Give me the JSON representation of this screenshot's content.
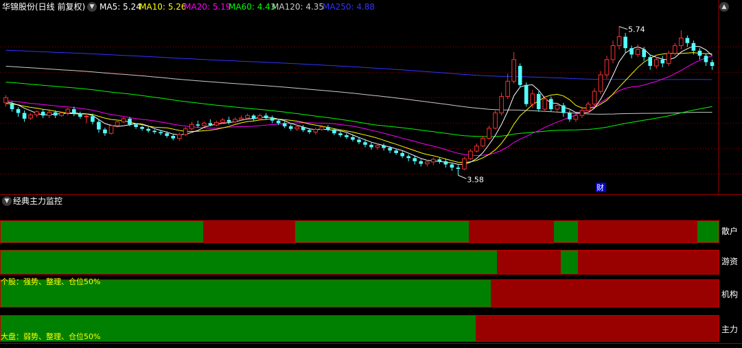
{
  "header": {
    "stock_label": "华锦股份(日线 前复权)",
    "ma_items": [
      {
        "label": "MA5: 5.24",
        "color": "#ffffff"
      },
      {
        "label": "MA10: 5.26",
        "color": "#ffff00"
      },
      {
        "label": "MA20: 5.19",
        "color": "#ff00ff"
      },
      {
        "label": "MA60: 4.43",
        "color": "#00ff00"
      },
      {
        "label": "MA120: 4.35",
        "color": "#cccccc"
      },
      {
        "label": "MA250: 4.88",
        "color": "#3333ff"
      }
    ]
  },
  "colors": {
    "up": "#ff3232",
    "down": "#54ffff",
    "bull": "#008000",
    "bear": "#990000",
    "grid": "#a00000",
    "annotation": "#ffffff",
    "event": "#0000cc"
  },
  "chart_data": {
    "type": "candlestick",
    "ylim": [
      3.4,
      6.1
    ],
    "high_label": "5.74",
    "low_label": "3.58",
    "event_label": "财",
    "candles": [
      [
        4.72,
        4.8,
        4.66,
        4.84
      ],
      [
        4.7,
        4.62,
        4.58,
        4.74
      ],
      [
        4.62,
        4.56,
        4.5,
        4.65
      ],
      [
        4.56,
        4.47,
        4.42,
        4.6
      ],
      [
        4.48,
        4.53,
        4.45,
        4.56
      ],
      [
        4.53,
        4.58,
        4.49,
        4.6
      ],
      [
        4.58,
        4.52,
        4.48,
        4.62
      ],
      [
        4.52,
        4.57,
        4.48,
        4.6
      ],
      [
        4.57,
        4.52,
        4.48,
        4.6
      ],
      [
        4.52,
        4.56,
        4.5,
        4.58
      ],
      [
        4.56,
        4.62,
        4.52,
        4.64
      ],
      [
        4.62,
        4.55,
        4.51,
        4.66
      ],
      [
        4.55,
        4.5,
        4.47,
        4.58
      ],
      [
        4.5,
        4.51,
        4.4,
        4.55
      ],
      [
        4.51,
        4.42,
        4.38,
        4.55
      ],
      [
        4.42,
        4.3,
        4.25,
        4.46
      ],
      [
        4.3,
        4.24,
        4.2,
        4.33
      ],
      [
        4.24,
        4.36,
        4.22,
        4.38
      ],
      [
        4.36,
        4.42,
        4.33,
        4.45
      ],
      [
        4.42,
        4.47,
        4.4,
        4.49
      ],
      [
        4.47,
        4.38,
        4.35,
        4.5
      ],
      [
        4.38,
        4.34,
        4.31,
        4.4
      ],
      [
        4.34,
        4.31,
        4.28,
        4.36
      ],
      [
        4.31,
        4.28,
        4.25,
        4.34
      ],
      [
        4.28,
        4.26,
        4.23,
        4.3
      ],
      [
        4.26,
        4.24,
        4.21,
        4.29
      ],
      [
        4.24,
        4.2,
        4.17,
        4.27
      ],
      [
        4.2,
        4.16,
        4.13,
        4.22
      ],
      [
        4.16,
        4.22,
        4.12,
        4.25
      ],
      [
        4.22,
        4.31,
        4.2,
        4.34
      ],
      [
        4.31,
        4.38,
        4.29,
        4.42
      ],
      [
        4.38,
        4.36,
        4.33,
        4.44
      ],
      [
        4.36,
        4.4,
        4.34,
        4.43
      ],
      [
        4.4,
        4.37,
        4.35,
        4.46
      ],
      [
        4.37,
        4.41,
        4.35,
        4.44
      ],
      [
        4.41,
        4.45,
        4.39,
        4.48
      ],
      [
        4.45,
        4.42,
        4.38,
        4.5
      ],
      [
        4.42,
        4.46,
        4.4,
        4.49
      ],
      [
        4.46,
        4.48,
        4.44,
        4.52
      ],
      [
        4.48,
        4.52,
        4.45,
        4.55
      ],
      [
        4.52,
        4.47,
        4.43,
        4.54
      ],
      [
        4.47,
        4.52,
        4.44,
        4.55
      ],
      [
        4.52,
        4.48,
        4.45,
        4.56
      ],
      [
        4.48,
        4.44,
        4.4,
        4.52
      ],
      [
        4.44,
        4.4,
        4.37,
        4.47
      ],
      [
        4.4,
        4.35,
        4.32,
        4.43
      ],
      [
        4.35,
        4.31,
        4.28,
        4.38
      ],
      [
        4.31,
        4.34,
        4.28,
        4.37
      ],
      [
        4.34,
        4.29,
        4.26,
        4.37
      ],
      [
        4.29,
        4.26,
        4.23,
        4.32
      ],
      [
        4.26,
        4.3,
        4.22,
        4.33
      ],
      [
        4.3,
        4.34,
        4.28,
        4.37
      ],
      [
        4.34,
        4.3,
        4.27,
        4.37
      ],
      [
        4.3,
        4.24,
        4.21,
        4.32
      ],
      [
        4.24,
        4.21,
        4.18,
        4.27
      ],
      [
        4.21,
        4.18,
        4.15,
        4.24
      ],
      [
        4.18,
        4.14,
        4.11,
        4.21
      ],
      [
        4.14,
        4.1,
        4.07,
        4.17
      ],
      [
        4.1,
        4.06,
        4.02,
        4.13
      ],
      [
        4.06,
        4.02,
        3.98,
        4.09
      ],
      [
        4.02,
        4.05,
        3.98,
        4.08
      ],
      [
        4.05,
        4.01,
        3.97,
        4.08
      ],
      [
        4.01,
        3.97,
        3.93,
        4.04
      ],
      [
        3.97,
        3.93,
        3.9,
        4.0
      ],
      [
        3.93,
        3.88,
        3.85,
        3.96
      ],
      [
        3.88,
        3.85,
        3.8,
        3.91
      ],
      [
        3.85,
        3.8,
        3.75,
        3.88
      ],
      [
        3.8,
        3.76,
        3.72,
        3.83
      ],
      [
        3.76,
        3.79,
        3.72,
        3.82
      ],
      [
        3.79,
        3.83,
        3.74,
        3.86
      ],
      [
        3.83,
        3.8,
        3.76,
        3.86
      ],
      [
        3.8,
        3.75,
        3.7,
        3.84
      ],
      [
        3.75,
        3.7,
        3.65,
        3.78
      ],
      [
        3.7,
        3.68,
        3.58,
        3.74
      ],
      [
        3.68,
        3.84,
        3.66,
        3.87
      ],
      [
        3.84,
        3.96,
        3.82,
        3.99
      ],
      [
        3.96,
        4.04,
        3.94,
        4.08
      ],
      [
        4.04,
        4.16,
        4.02,
        4.2
      ],
      [
        4.16,
        4.32,
        4.14,
        4.36
      ],
      [
        4.32,
        4.56,
        4.3,
        4.6
      ],
      [
        4.56,
        4.82,
        4.52,
        4.88
      ],
      [
        4.82,
        5.06,
        4.78,
        5.18
      ],
      [
        5.06,
        5.4,
        5.02,
        5.52
      ],
      [
        5.3,
        5.0,
        4.96,
        5.34
      ],
      [
        5.0,
        4.7,
        4.66,
        5.04
      ],
      [
        4.7,
        4.86,
        4.64,
        4.92
      ],
      [
        4.86,
        4.62,
        4.58,
        4.9
      ],
      [
        4.62,
        4.78,
        4.58,
        4.82
      ],
      [
        4.78,
        4.62,
        4.58,
        4.82
      ],
      [
        4.62,
        4.68,
        4.56,
        4.72
      ],
      [
        4.68,
        4.56,
        4.5,
        4.72
      ],
      [
        4.56,
        4.46,
        4.42,
        4.6
      ],
      [
        4.46,
        4.52,
        4.42,
        4.56
      ],
      [
        4.52,
        4.6,
        4.48,
        4.66
      ],
      [
        4.6,
        4.7,
        4.56,
        4.74
      ],
      [
        4.7,
        4.9,
        4.66,
        4.95
      ],
      [
        4.9,
        5.16,
        4.86,
        5.22
      ],
      [
        5.16,
        5.4,
        5.1,
        5.46
      ],
      [
        5.4,
        5.62,
        5.34,
        5.7
      ],
      [
        5.62,
        5.76,
        5.56,
        5.92
      ],
      [
        5.76,
        5.58,
        5.5,
        5.82
      ],
      [
        5.58,
        5.48,
        5.42,
        5.62
      ],
      [
        5.48,
        5.56,
        5.44,
        5.64
      ],
      [
        5.56,
        5.44,
        5.38,
        5.6
      ],
      [
        5.44,
        5.3,
        5.24,
        5.48
      ],
      [
        5.3,
        5.4,
        5.26,
        5.44
      ],
      [
        5.4,
        5.34,
        5.28,
        5.46
      ],
      [
        5.34,
        5.5,
        5.3,
        5.54
      ],
      [
        5.5,
        5.62,
        5.46,
        5.66
      ],
      [
        5.62,
        5.74,
        5.56,
        5.86
      ],
      [
        5.74,
        5.66,
        5.6,
        5.78
      ],
      [
        5.66,
        5.54,
        5.48,
        5.7
      ],
      [
        5.54,
        5.46,
        5.4,
        5.58
      ],
      [
        5.46,
        5.36,
        5.3,
        5.5
      ],
      [
        5.36,
        5.3,
        5.24,
        5.4
      ]
    ]
  },
  "monitor": {
    "title": "经典主力监控",
    "rows": [
      {
        "label": "散户",
        "segments": [
          [
            "bull",
            0,
            0.282
          ],
          [
            "bear",
            0.282,
            0.41
          ],
          [
            "bull",
            0.41,
            0.652
          ],
          [
            "bear",
            0.652,
            0.771
          ],
          [
            "bull",
            0.771,
            0.804
          ],
          [
            "bear",
            0.804,
            0.97
          ],
          [
            "bull",
            0.97,
            1
          ]
        ]
      },
      {
        "label": "游资",
        "segments": [
          [
            "bull",
            0,
            0.691
          ],
          [
            "bear",
            0.691,
            0.78
          ],
          [
            "bull",
            0.78,
            0.804
          ],
          [
            "bear",
            0.804,
            1
          ]
        ]
      },
      {
        "label": "机构",
        "segments": [
          [
            "bull",
            0,
            0.683
          ],
          [
            "bear",
            0.683,
            1
          ]
        ]
      },
      {
        "label": "主力",
        "segments": [
          [
            "bull",
            0,
            0.662
          ],
          [
            "bear",
            0.662,
            1
          ]
        ]
      }
    ],
    "stock_note": "个股：强势、整理、仓位50%",
    "market_note": "大盘：弱势、整理、仓位50%"
  }
}
